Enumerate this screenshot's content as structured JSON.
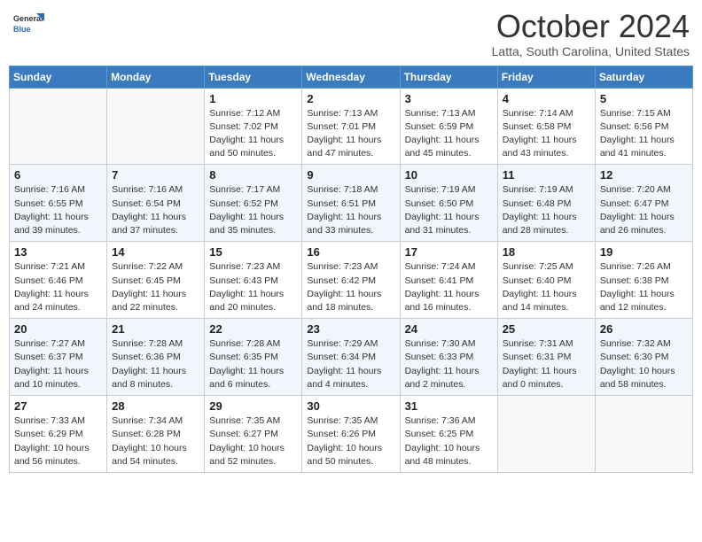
{
  "header": {
    "logo_general": "General",
    "logo_blue": "Blue",
    "month_title": "October 2024",
    "subtitle": "Latta, South Carolina, United States"
  },
  "days_of_week": [
    "Sunday",
    "Monday",
    "Tuesday",
    "Wednesday",
    "Thursday",
    "Friday",
    "Saturday"
  ],
  "weeks": [
    [
      {
        "day": "",
        "empty": true
      },
      {
        "day": "",
        "empty": true
      },
      {
        "day": "1",
        "sunrise": "7:12 AM",
        "sunset": "7:02 PM",
        "daylight": "11 hours and 50 minutes."
      },
      {
        "day": "2",
        "sunrise": "7:13 AM",
        "sunset": "7:01 PM",
        "daylight": "11 hours and 47 minutes."
      },
      {
        "day": "3",
        "sunrise": "7:13 AM",
        "sunset": "6:59 PM",
        "daylight": "11 hours and 45 minutes."
      },
      {
        "day": "4",
        "sunrise": "7:14 AM",
        "sunset": "6:58 PM",
        "daylight": "11 hours and 43 minutes."
      },
      {
        "day": "5",
        "sunrise": "7:15 AM",
        "sunset": "6:56 PM",
        "daylight": "11 hours and 41 minutes."
      }
    ],
    [
      {
        "day": "6",
        "sunrise": "7:16 AM",
        "sunset": "6:55 PM",
        "daylight": "11 hours and 39 minutes."
      },
      {
        "day": "7",
        "sunrise": "7:16 AM",
        "sunset": "6:54 PM",
        "daylight": "11 hours and 37 minutes."
      },
      {
        "day": "8",
        "sunrise": "7:17 AM",
        "sunset": "6:52 PM",
        "daylight": "11 hours and 35 minutes."
      },
      {
        "day": "9",
        "sunrise": "7:18 AM",
        "sunset": "6:51 PM",
        "daylight": "11 hours and 33 minutes."
      },
      {
        "day": "10",
        "sunrise": "7:19 AM",
        "sunset": "6:50 PM",
        "daylight": "11 hours and 31 minutes."
      },
      {
        "day": "11",
        "sunrise": "7:19 AM",
        "sunset": "6:48 PM",
        "daylight": "11 hours and 28 minutes."
      },
      {
        "day": "12",
        "sunrise": "7:20 AM",
        "sunset": "6:47 PM",
        "daylight": "11 hours and 26 minutes."
      }
    ],
    [
      {
        "day": "13",
        "sunrise": "7:21 AM",
        "sunset": "6:46 PM",
        "daylight": "11 hours and 24 minutes."
      },
      {
        "day": "14",
        "sunrise": "7:22 AM",
        "sunset": "6:45 PM",
        "daylight": "11 hours and 22 minutes."
      },
      {
        "day": "15",
        "sunrise": "7:23 AM",
        "sunset": "6:43 PM",
        "daylight": "11 hours and 20 minutes."
      },
      {
        "day": "16",
        "sunrise": "7:23 AM",
        "sunset": "6:42 PM",
        "daylight": "11 hours and 18 minutes."
      },
      {
        "day": "17",
        "sunrise": "7:24 AM",
        "sunset": "6:41 PM",
        "daylight": "11 hours and 16 minutes."
      },
      {
        "day": "18",
        "sunrise": "7:25 AM",
        "sunset": "6:40 PM",
        "daylight": "11 hours and 14 minutes."
      },
      {
        "day": "19",
        "sunrise": "7:26 AM",
        "sunset": "6:38 PM",
        "daylight": "11 hours and 12 minutes."
      }
    ],
    [
      {
        "day": "20",
        "sunrise": "7:27 AM",
        "sunset": "6:37 PM",
        "daylight": "11 hours and 10 minutes."
      },
      {
        "day": "21",
        "sunrise": "7:28 AM",
        "sunset": "6:36 PM",
        "daylight": "11 hours and 8 minutes."
      },
      {
        "day": "22",
        "sunrise": "7:28 AM",
        "sunset": "6:35 PM",
        "daylight": "11 hours and 6 minutes."
      },
      {
        "day": "23",
        "sunrise": "7:29 AM",
        "sunset": "6:34 PM",
        "daylight": "11 hours and 4 minutes."
      },
      {
        "day": "24",
        "sunrise": "7:30 AM",
        "sunset": "6:33 PM",
        "daylight": "11 hours and 2 minutes."
      },
      {
        "day": "25",
        "sunrise": "7:31 AM",
        "sunset": "6:31 PM",
        "daylight": "11 hours and 0 minutes."
      },
      {
        "day": "26",
        "sunrise": "7:32 AM",
        "sunset": "6:30 PM",
        "daylight": "10 hours and 58 minutes."
      }
    ],
    [
      {
        "day": "27",
        "sunrise": "7:33 AM",
        "sunset": "6:29 PM",
        "daylight": "10 hours and 56 minutes."
      },
      {
        "day": "28",
        "sunrise": "7:34 AM",
        "sunset": "6:28 PM",
        "daylight": "10 hours and 54 minutes."
      },
      {
        "day": "29",
        "sunrise": "7:35 AM",
        "sunset": "6:27 PM",
        "daylight": "10 hours and 52 minutes."
      },
      {
        "day": "30",
        "sunrise": "7:35 AM",
        "sunset": "6:26 PM",
        "daylight": "10 hours and 50 minutes."
      },
      {
        "day": "31",
        "sunrise": "7:36 AM",
        "sunset": "6:25 PM",
        "daylight": "10 hours and 48 minutes."
      },
      {
        "day": "",
        "empty": true
      },
      {
        "day": "",
        "empty": true
      }
    ]
  ]
}
